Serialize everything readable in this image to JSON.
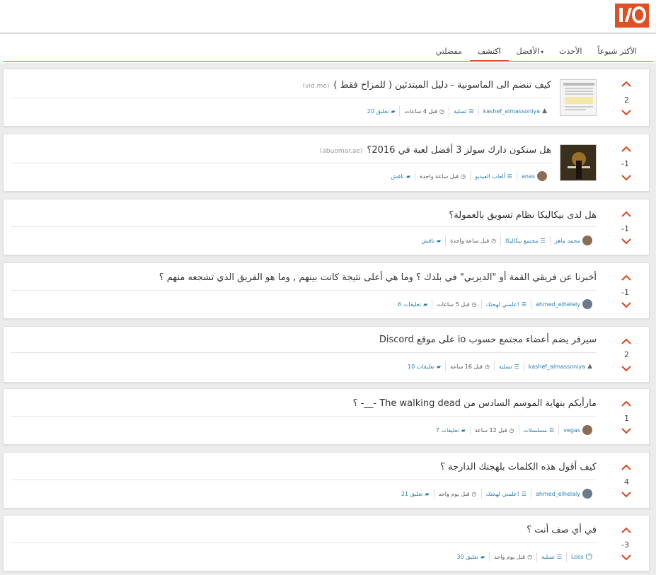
{
  "header": {
    "logo_text": "I/O",
    "accent": "#e04e24"
  },
  "tabs": [
    {
      "label": "الأكثر شيوعاً"
    },
    {
      "label": "الأحدث"
    },
    {
      "label": "الأفضل"
    },
    {
      "label": "اكتشف",
      "active": true
    },
    {
      "label": "مفضلتي"
    }
  ],
  "posts": [
    {
      "title": "كيف تنضم الى الماسونية - دليل المبتدئين ( للمزاح فقط )",
      "domain": "(vid.me)",
      "score": "2",
      "user": "kashef_almassoniya",
      "category": "تسلية",
      "time": "قبل 4 ساعات",
      "comments": "20 تعليق"
    },
    {
      "title": "هل ستكون دارك سولز 3 أفضل لعبة في 2016؟",
      "domain": "(abuomar.ae)",
      "score": "-1",
      "user": "anas",
      "category": "ألعاب الفيديو",
      "time": "قبل ساعة واحدة",
      "comments": "ناقش"
    },
    {
      "title": "هل لدى بيكاليكا نظام تسويق بالعمولة؟",
      "domain": "",
      "score": "-1",
      "user": "محمد ماهر",
      "category": "مجتمع بيكاليكا",
      "time": "قبل ساعة واحدة",
      "comments": "ناقش"
    },
    {
      "title": "أخبرنا عن فريقي القمة أو \"الديربي\" في بلدك ؟ وما هي أعلى نتيجة كانت بينهم , وما هو الفريق الذي تشجعه منهم ؟",
      "domain": "",
      "score": "-1",
      "user": "ahmed_elhelaly",
      "category": "علمني لهجتك!",
      "time": "قبل 5 ساعات",
      "comments": "6 تعليقات"
    },
    {
      "title": "سيرفر يضم أعضاء مجتمع حسوب io على موقع Discord",
      "domain": "",
      "score": "2",
      "user": "kashef_almassoniya",
      "category": "تسلية",
      "time": "قبل 16 ساعة",
      "comments": "10 تعليقات"
    },
    {
      "title": "مارأيكم بنهاية الموسم السادس من The walking dead -__- ؟",
      "domain": "",
      "score": "1",
      "user": "vegas",
      "category": "مسلسلات",
      "time": "قبل 12 ساعة",
      "comments": "7 تعليقات"
    },
    {
      "title": "كيف أقول هذه الكلمات بلهجتك الدارجة ؟",
      "domain": "",
      "score": "4",
      "user": "ahmed_elhelaly",
      "category": "علمني لهجتك!",
      "time": "قبل يوم واحد",
      "comments": "21 تعليق"
    },
    {
      "title": "في أي صف أنت ؟",
      "domain": "",
      "score": "-3",
      "user": "Loss",
      "category": "تسلية",
      "time": "قبل يوم واحد",
      "comments": "30 تعليق"
    }
  ]
}
